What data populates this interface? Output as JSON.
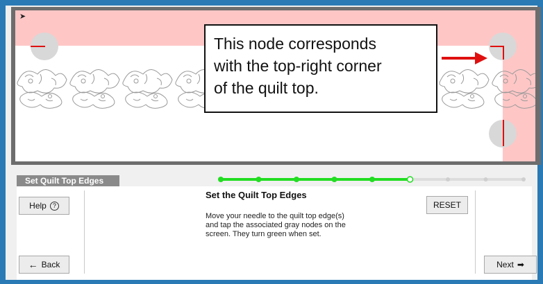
{
  "callout": {
    "line1": "This node corresponds",
    "line2": "with the top-right corner",
    "line3": "of the quilt top."
  },
  "header": {
    "title": "Set Quilt Top Edges"
  },
  "progress": {
    "total_steps": 9,
    "completed_steps": 5,
    "current_step": 6
  },
  "step": {
    "title": "Set the Quilt Top Edges",
    "line1": "Move your needle to the quilt top edge(s)",
    "line2": "and tap the associated gray nodes on the",
    "line3": "screen. They turn green when set."
  },
  "buttons": {
    "help": "Help",
    "help_icon": "?",
    "back": "Back",
    "back_icon": "←",
    "next": "Next",
    "next_icon": "➡",
    "reset": "RESET"
  },
  "colors": {
    "accent": "#2a7ab5",
    "progress_done": "#22dd22",
    "progress_todo": "#dddddd",
    "marker": "#e01010",
    "out_of_bounds": "#ffc6c6"
  },
  "icons": [
    "cursor-icon",
    "help-icon",
    "back-arrow-icon",
    "next-arrow-icon",
    "pointer-arrow-icon"
  ]
}
